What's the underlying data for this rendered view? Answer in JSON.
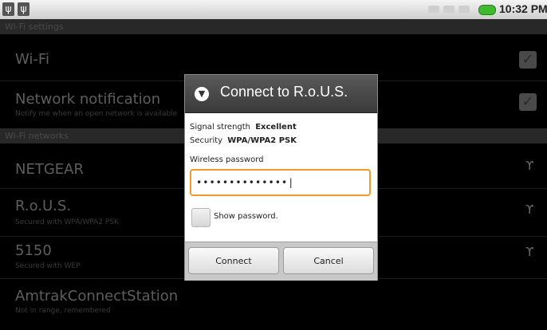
{
  "status_bar": {
    "time": "10:32 PM",
    "icons": [
      "usb-icon",
      "usb-icon",
      "signal-icon",
      "signal-icon",
      "signal-icon",
      "battery-icon"
    ]
  },
  "background": {
    "header": "Wi-Fi settings",
    "wifi": {
      "title": "Wi-Fi"
    },
    "notification": {
      "title": "Network notification",
      "subtitle": "Notify me when an open network is available"
    },
    "networks_header": "Wi-Fi networks",
    "networks": [
      {
        "name": "NETGEAR",
        "status": ""
      },
      {
        "name": "R.o.U.S.",
        "status": "Secured with WPA/WPA2 PSK"
      },
      {
        "name": "5150",
        "status": "Secured with WEP"
      },
      {
        "name": "AmtrakConnectStation",
        "status": "Not in range, remembered"
      }
    ]
  },
  "dialog": {
    "title": "Connect to R.o.U.S.",
    "signal_label": "Signal strength",
    "signal_value": "Excellent",
    "security_label": "Security",
    "security_value": "WPA/WPA2 PSK",
    "password_label": "Wireless password",
    "password_value": "••••••••••••••|",
    "show_password_label": "Show password.",
    "connect_label": "Connect",
    "cancel_label": "Cancel"
  }
}
